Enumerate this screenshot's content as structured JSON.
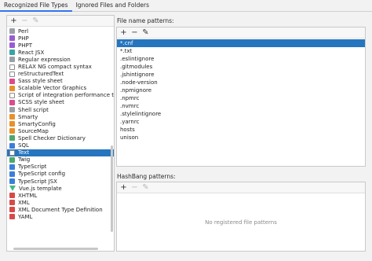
{
  "tabs": [
    {
      "label": "Recognized File Types",
      "active": true
    },
    {
      "label": "Ignored Files and Folders",
      "active": false
    }
  ],
  "left_toolbar": [
    {
      "icon": "plus-icon",
      "glyph": "+",
      "enabled": true
    },
    {
      "icon": "minus-icon",
      "glyph": "−",
      "enabled": false
    },
    {
      "icon": "pencil-icon",
      "glyph": "✎",
      "enabled": false
    }
  ],
  "file_types": [
    {
      "label": "Perl",
      "icon": "perl-icon",
      "color": "gray"
    },
    {
      "label": "PHP",
      "icon": "php-icon",
      "color": "purple"
    },
    {
      "label": "PHPT",
      "icon": "phpt-icon",
      "color": "purple"
    },
    {
      "label": "React JSX",
      "icon": "react-jsx-icon",
      "color": "teal"
    },
    {
      "label": "Regular expression",
      "icon": "regex-icon",
      "color": "gray"
    },
    {
      "label": "RELAX NG compact syntax",
      "icon": "relax-ng-icon",
      "color": "doc"
    },
    {
      "label": "reStructuredText",
      "icon": "rst-icon",
      "color": "doc"
    },
    {
      "label": "Sass style sheet",
      "icon": "sass-icon",
      "color": "pink"
    },
    {
      "label": "Scalable Vector Graphics",
      "icon": "svg-icon",
      "color": "orange"
    },
    {
      "label": "Script of integration performance t",
      "icon": "script-icon",
      "color": "doc"
    },
    {
      "label": "SCSS style sheet",
      "icon": "scss-icon",
      "color": "pink"
    },
    {
      "label": "Shell script",
      "icon": "shell-icon",
      "color": "gray"
    },
    {
      "label": "Smarty",
      "icon": "smarty-icon",
      "color": "orange"
    },
    {
      "label": "SmartyConfig",
      "icon": "smarty-config-icon",
      "color": "orange"
    },
    {
      "label": "SourceMap",
      "icon": "sourcemap-icon",
      "color": "orange"
    },
    {
      "label": "Spell Checker Dictionary",
      "icon": "dictionary-icon",
      "color": "green"
    },
    {
      "label": "SQL",
      "icon": "sql-icon",
      "color": "blue"
    },
    {
      "label": "Text",
      "icon": "text-icon",
      "color": "doc",
      "selected": true
    },
    {
      "label": "Twig",
      "icon": "twig-icon",
      "color": "green"
    },
    {
      "label": "TypeScript",
      "icon": "typescript-icon",
      "color": "blue"
    },
    {
      "label": "TypeScript config",
      "icon": "ts-config-icon",
      "color": "blue"
    },
    {
      "label": "TypeScript JSX",
      "icon": "tsx-icon",
      "color": "blue"
    },
    {
      "label": "Vue.js template",
      "icon": "vue-icon",
      "color": "vue"
    },
    {
      "label": "XHTML",
      "icon": "xhtml-icon",
      "color": "red"
    },
    {
      "label": "XML",
      "icon": "xml-icon",
      "color": "red"
    },
    {
      "label": "XML Document Type Definition",
      "icon": "dtd-icon",
      "color": "red"
    },
    {
      "label": "YAML",
      "icon": "yaml-icon",
      "color": "red"
    }
  ],
  "file_name_patterns": {
    "label": "File name patterns:",
    "toolbar": [
      {
        "icon": "plus-icon",
        "glyph": "+",
        "enabled": true
      },
      {
        "icon": "minus-icon",
        "glyph": "−",
        "enabled": true
      },
      {
        "icon": "pencil-icon",
        "glyph": "✎",
        "enabled": true
      }
    ],
    "items": [
      "*.cnf",
      "*.txt",
      ".eslintignore",
      ".gitmodules",
      ".jshintignore",
      ".node-version",
      ".npmignore",
      ".npmrc",
      ".nvmrc",
      ".stylelintignore",
      ".yarnrc",
      "hosts",
      "unison"
    ],
    "selected_index": 0
  },
  "hashbang_patterns": {
    "label": "HashBang patterns:",
    "toolbar": [
      {
        "icon": "plus-icon",
        "glyph": "+",
        "enabled": true
      },
      {
        "icon": "minus-icon",
        "glyph": "−",
        "enabled": false
      },
      {
        "icon": "pencil-icon",
        "glyph": "✎",
        "enabled": false
      }
    ],
    "empty_text": "No registered file patterns"
  }
}
